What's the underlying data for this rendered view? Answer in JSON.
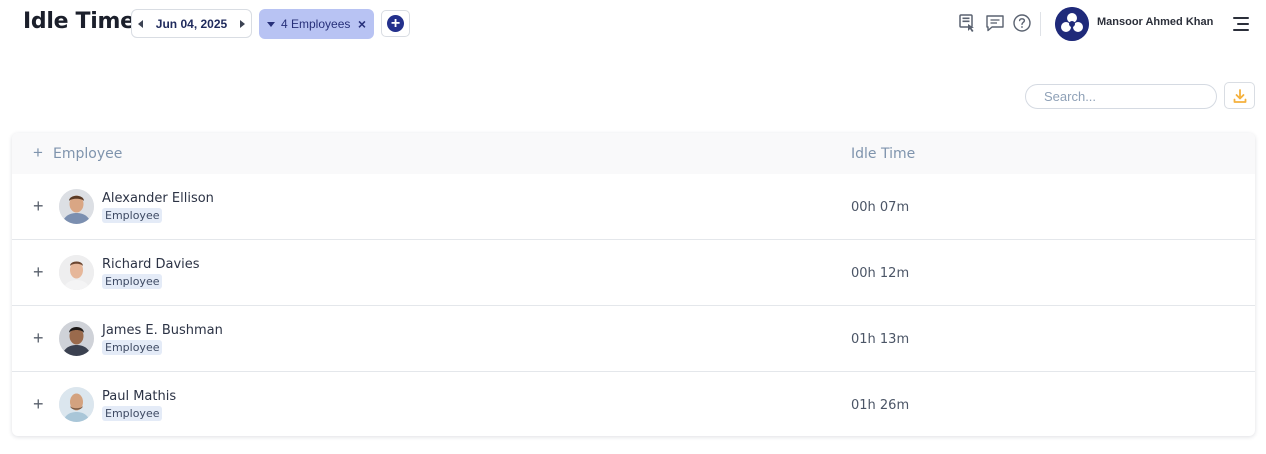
{
  "header": {
    "title": "Idle Time",
    "date": "Jun 04, 2025",
    "employee_filter": "4 Employees",
    "user_name": "Mansoor Ahmed Khan"
  },
  "icons": {
    "timesheet": "timesheet-icon",
    "chat": "chat-icon",
    "help": "help-icon",
    "menu": "menu-icon",
    "download": "download-icon"
  },
  "colors": {
    "brand": "#1f2a7a",
    "chip": "#b8c3f3",
    "download_accent": "#f5b13d",
    "header_text": "#7f94ad"
  },
  "toolbar": {
    "search_placeholder": "Search..."
  },
  "table": {
    "columns": [
      "Employee",
      "Idle Time"
    ],
    "rows": [
      {
        "name": "Alexander Ellison",
        "role": "Employee",
        "idle": "00h 07m"
      },
      {
        "name": "Richard Davies",
        "role": "Employee",
        "idle": "00h 12m"
      },
      {
        "name": "James E. Bushman",
        "role": "Employee",
        "idle": "01h 13m"
      },
      {
        "name": "Paul Mathis",
        "role": "Employee",
        "idle": "01h 26m"
      }
    ]
  }
}
